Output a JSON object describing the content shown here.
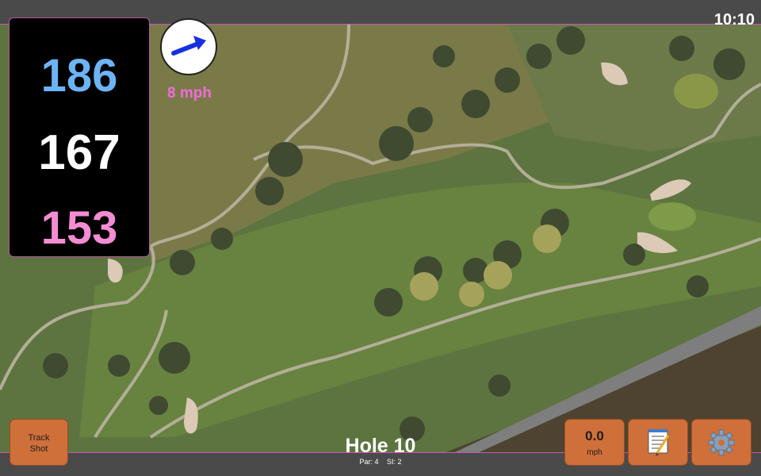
{
  "status": {
    "time": "10:10"
  },
  "distances": {
    "back": "186",
    "middle": "167",
    "front": "153"
  },
  "wind": {
    "speed_label": "8 mph",
    "icon": "wind-arrow-icon"
  },
  "hole": {
    "title": "Hole 10",
    "par": "Par: 4",
    "stroke_index": "SI: 2"
  },
  "buttons": {
    "track_shot_line1": "Track",
    "track_shot_line2": "Shot",
    "speed_value": "0.0",
    "speed_unit": "mph",
    "notes_icon": "notepad-icon",
    "settings_icon": "gear-icon"
  },
  "colors": {
    "back": "#6cb4f6",
    "middle": "#ffffff",
    "front": "#f48cd3",
    "wind_text": "#f06cd8",
    "button": "#cf6f3a",
    "accent_border": "#c35bb0"
  }
}
